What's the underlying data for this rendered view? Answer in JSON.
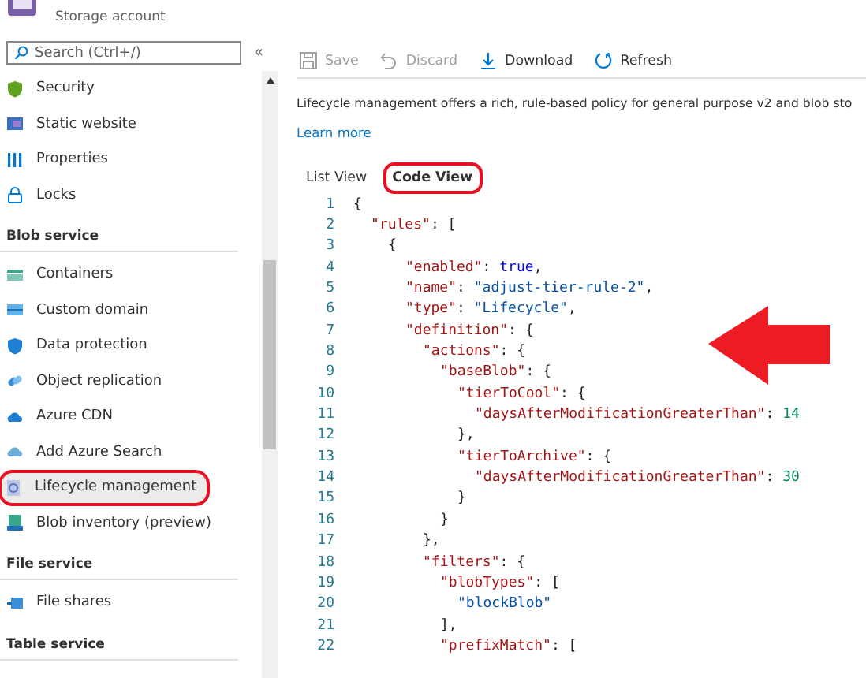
{
  "header": {
    "subtitle": "Storage account"
  },
  "search": {
    "placeholder": "Search (Ctrl+/)"
  },
  "collapse": "«",
  "sidebar": {
    "items": [
      {
        "kind": "item",
        "label": "Security",
        "selected": false,
        "highlighted": false
      },
      {
        "kind": "item",
        "label": "Static website",
        "selected": false,
        "highlighted": false
      },
      {
        "kind": "item",
        "label": "Properties",
        "selected": false,
        "highlighted": false
      },
      {
        "kind": "item",
        "label": "Locks",
        "selected": false,
        "highlighted": false
      },
      {
        "kind": "section",
        "label": "Blob service"
      },
      {
        "kind": "item",
        "label": "Containers",
        "selected": false,
        "highlighted": false
      },
      {
        "kind": "item",
        "label": "Custom domain",
        "selected": false,
        "highlighted": false
      },
      {
        "kind": "item",
        "label": "Data protection",
        "selected": false,
        "highlighted": false
      },
      {
        "kind": "item",
        "label": "Object replication",
        "selected": false,
        "highlighted": false
      },
      {
        "kind": "item",
        "label": "Azure CDN",
        "selected": false,
        "highlighted": false
      },
      {
        "kind": "item",
        "label": "Add Azure Search",
        "selected": false,
        "highlighted": false
      },
      {
        "kind": "item",
        "label": "Lifecycle management",
        "selected": true,
        "highlighted": true
      },
      {
        "kind": "item",
        "label": "Blob inventory (preview)",
        "selected": false,
        "highlighted": false
      },
      {
        "kind": "section",
        "label": "File service"
      },
      {
        "kind": "item",
        "label": "File shares",
        "selected": false,
        "highlighted": false
      },
      {
        "kind": "section",
        "label": "Table service"
      }
    ]
  },
  "toolbar": [
    {
      "label": "Save",
      "disabled": true
    },
    {
      "label": "Discard",
      "disabled": true
    },
    {
      "label": "Download",
      "disabled": false
    },
    {
      "label": "Refresh",
      "disabled": false
    }
  ],
  "description": "Lifecycle management offers a rich, rule-based policy for general purpose v2 and blob sto",
  "learn_more": "Learn more",
  "tabs": [
    {
      "label": "List View",
      "selected": false,
      "highlighted": false
    },
    {
      "label": "Code View",
      "selected": true,
      "highlighted": true
    }
  ],
  "code": [
    {
      "number": "1",
      "tokens": [
        {
          "kind": "punct",
          "text": "{"
        }
      ]
    },
    {
      "number": "2",
      "tokens": [
        {
          "kind": "key",
          "text": "\"rules\""
        },
        {
          "kind": "punct",
          "text": ": ["
        }
      ]
    },
    {
      "number": "3",
      "tokens": [
        {
          "kind": "punct",
          "text": "{"
        }
      ]
    },
    {
      "number": "4",
      "tokens": [
        {
          "kind": "key",
          "text": "\"enabled\""
        },
        {
          "kind": "punct",
          "text": ": "
        },
        {
          "kind": "bool",
          "text": "true"
        },
        {
          "kind": "punct",
          "text": ","
        }
      ]
    },
    {
      "number": "5",
      "tokens": [
        {
          "kind": "key",
          "text": "\"name\""
        },
        {
          "kind": "punct",
          "text": ": "
        },
        {
          "kind": "string",
          "text": "\"adjust-tier-rule-2\""
        },
        {
          "kind": "punct",
          "text": ","
        }
      ]
    },
    {
      "number": "6",
      "tokens": [
        {
          "kind": "key",
          "text": "\"type\""
        },
        {
          "kind": "punct",
          "text": ": "
        },
        {
          "kind": "string",
          "text": "\"Lifecycle\""
        },
        {
          "kind": "punct",
          "text": ","
        }
      ]
    },
    {
      "number": "7",
      "tokens": [
        {
          "kind": "key",
          "text": "\"definition\""
        },
        {
          "kind": "punct",
          "text": ": {"
        }
      ]
    },
    {
      "number": "8",
      "tokens": [
        {
          "kind": "key",
          "text": "\"actions\""
        },
        {
          "kind": "punct",
          "text": ": {"
        }
      ]
    },
    {
      "number": "9",
      "tokens": [
        {
          "kind": "key",
          "text": "\"baseBlob\""
        },
        {
          "kind": "punct",
          "text": ": {"
        }
      ]
    },
    {
      "number": "10",
      "tokens": [
        {
          "kind": "key",
          "text": "\"tierToCool\""
        },
        {
          "kind": "punct",
          "text": ": {"
        }
      ]
    },
    {
      "number": "11",
      "tokens": [
        {
          "kind": "key",
          "text": "\"daysAfterModificationGreaterThan\""
        },
        {
          "kind": "punct",
          "text": ": "
        },
        {
          "kind": "number",
          "text": "14"
        }
      ]
    },
    {
      "number": "12",
      "tokens": [
        {
          "kind": "punct",
          "text": "},"
        }
      ]
    },
    {
      "number": "13",
      "tokens": [
        {
          "kind": "key",
          "text": "\"tierToArchive\""
        },
        {
          "kind": "punct",
          "text": ": {"
        }
      ]
    },
    {
      "number": "14",
      "tokens": [
        {
          "kind": "key",
          "text": "\"daysAfterModificationGreaterThan\""
        },
        {
          "kind": "punct",
          "text": ": "
        },
        {
          "kind": "number",
          "text": "30"
        }
      ]
    },
    {
      "number": "15",
      "tokens": [
        {
          "kind": "punct",
          "text": "}"
        }
      ]
    },
    {
      "number": "16",
      "tokens": [
        {
          "kind": "punct",
          "text": "}"
        }
      ]
    },
    {
      "number": "17",
      "tokens": [
        {
          "kind": "punct",
          "text": "},"
        }
      ]
    },
    {
      "number": "18",
      "tokens": [
        {
          "kind": "key",
          "text": "\"filters\""
        },
        {
          "kind": "punct",
          "text": ": {"
        }
      ]
    },
    {
      "number": "19",
      "tokens": [
        {
          "kind": "key",
          "text": "\"blobTypes\""
        },
        {
          "kind": "punct",
          "text": ": ["
        }
      ]
    },
    {
      "number": "20",
      "tokens": [
        {
          "kind": "string",
          "text": "\"blockBlob\""
        }
      ]
    },
    {
      "number": "21",
      "tokens": [
        {
          "kind": "punct",
          "text": "],"
        }
      ]
    },
    {
      "number": "22",
      "tokens": [
        {
          "kind": "key",
          "text": "\"prefixMatch\""
        },
        {
          "kind": "punct",
          "text": ": ["
        }
      ]
    }
  ]
}
